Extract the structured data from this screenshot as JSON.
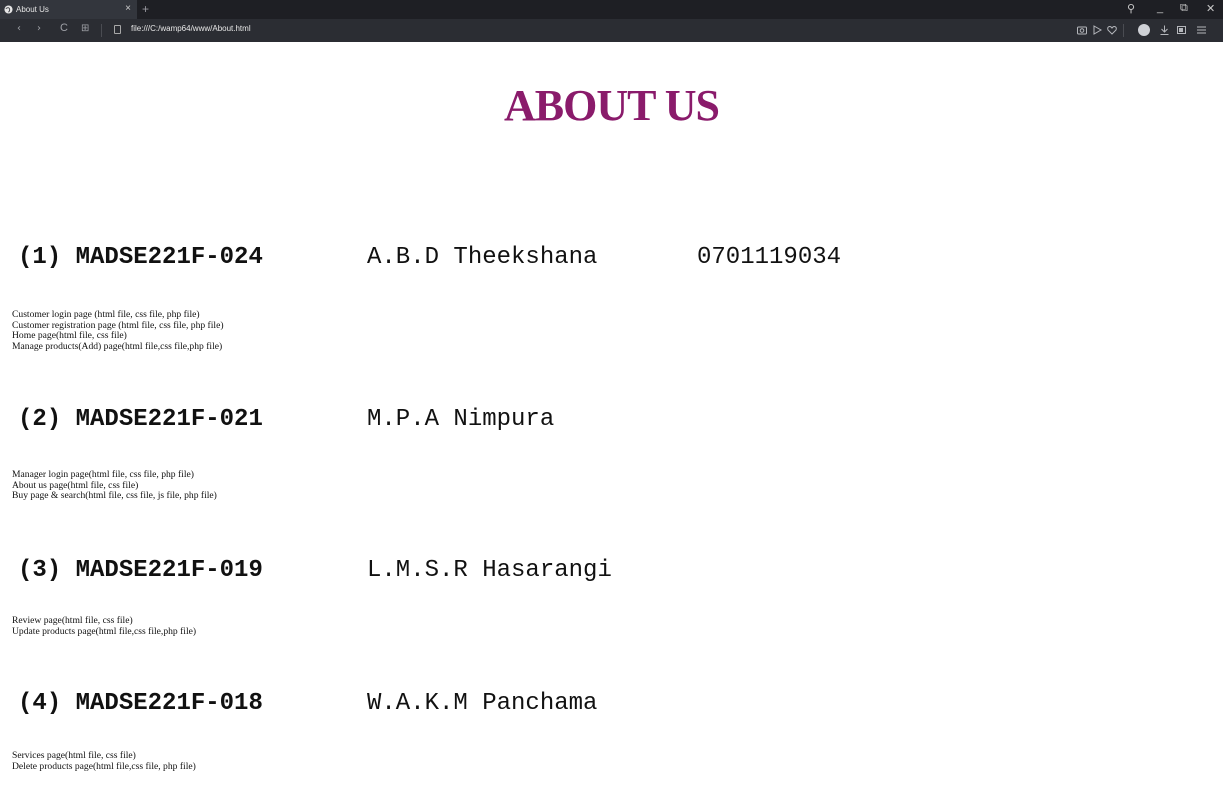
{
  "browser": {
    "tab_title": "About Us",
    "tab_close": "×",
    "new_tab": "+",
    "url": "file:///C:/wamp64/www/About.html",
    "nav": {
      "back": "‹",
      "forward": "›",
      "reload": "C",
      "grid": "⊞"
    },
    "window": {
      "search": "⚲",
      "minimize": "_",
      "restore": "⧉",
      "close": "✕"
    },
    "toolbar_icons": [
      "camera-icon",
      "play-icon",
      "heart-icon",
      "profile-icon",
      "download-icon",
      "battery-icon",
      "menu-icon"
    ]
  },
  "page": {
    "title": "ABOUT US",
    "members": [
      {
        "index": "(1)",
        "id": "MADSE221F-024",
        "name": "A.B.D Theekshana",
        "phone": "0701119034",
        "tasks": [
          "Customer login page (html file, css file, php file)",
          "Customer registration page (html file, css file, php file)",
          "Home page(html file, css file)",
          "Manage products(Add) page(html file,css file,php file)"
        ]
      },
      {
        "index": "(2)",
        "id": "MADSE221F-021",
        "name": "M.P.A Nimpura",
        "tasks": [
          "Manager login page(html file, css file, php file)",
          "About us page(html file, css file)",
          "Buy page & search(html file, css file, js file, php file)"
        ]
      },
      {
        "index": "(3)",
        "id": "MADSE221F-019",
        "name": "L.M.S.R Hasarangi",
        "tasks": [
          "Review page(html file, css file)",
          "Update products page(html file,css file,php file)"
        ]
      },
      {
        "index": "(4)",
        "id": "MADSE221F-018",
        "name": "W.A.K.M Panchama",
        "tasks": [
          "Services page(html file, css file)",
          "Delete products page(html file,css file, php file)"
        ]
      }
    ]
  }
}
